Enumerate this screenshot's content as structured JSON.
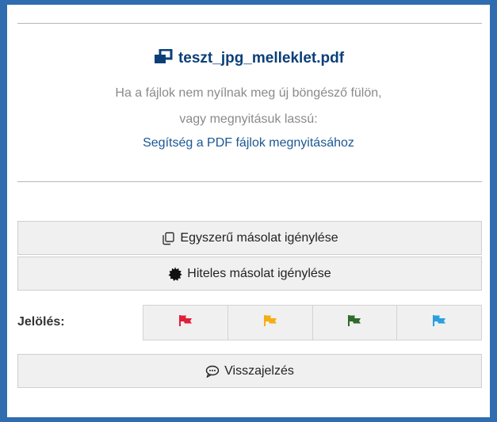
{
  "file": {
    "name": "teszt_jpg_melleklet.pdf",
    "icon": "external-window-icon"
  },
  "hint": {
    "line1": "Ha a fájlok nem nyílnak meg új böngésző fülön,",
    "line2": "vagy megnyitásuk lassú:",
    "help_link": "Segítség a PDF fájlok megnyitásához"
  },
  "actions": {
    "simple_copy": "Egyszerű másolat igénylése",
    "certified_copy": "Hiteles másolat igénylése",
    "feedback": "Visszajelzés"
  },
  "marking": {
    "label": "Jelölés:",
    "flags": [
      {
        "name": "red",
        "color": "#e0213b"
      },
      {
        "name": "yellow",
        "color": "#f5ae11"
      },
      {
        "name": "green",
        "color": "#2f6b2c"
      },
      {
        "name": "blue",
        "color": "#2b9ee0"
      }
    ]
  },
  "colors": {
    "frame": "#2f6db0",
    "title": "#0b3f78",
    "link": "#1b5793",
    "hint": "#8a8a8a"
  }
}
